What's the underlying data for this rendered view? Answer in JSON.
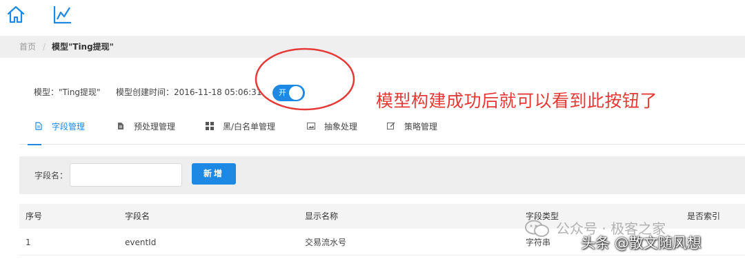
{
  "topnav": {
    "icons": [
      "home-icon",
      "chart-icon"
    ]
  },
  "breadcrumb": {
    "home": "首页",
    "separator": "/",
    "current": "模型\"Ting提现\""
  },
  "model": {
    "name_text": "模型：\"Ting提现\"",
    "created_text": "模型创建时间：2016-11-18 05:06:31",
    "toggle_label": "开",
    "toggle_on": true
  },
  "annotation": {
    "text": "模型构建成功后就可以看到此按钮了",
    "color": "#e53935"
  },
  "tabs": [
    {
      "label": "字段管理",
      "icon": "document-icon",
      "active": true
    },
    {
      "label": "预处理管理",
      "icon": "file-icon",
      "active": false
    },
    {
      "label": "黑/白名单管理",
      "icon": "grid-icon",
      "active": false
    },
    {
      "label": "抽象处理",
      "icon": "image-icon",
      "active": false
    },
    {
      "label": "策略管理",
      "icon": "edit-icon",
      "active": false
    }
  ],
  "filter": {
    "label": "字段名：",
    "input_value": "",
    "add_button": "新增"
  },
  "table": {
    "headers": [
      "序号",
      "字段名",
      "显示名称",
      "字段类型",
      "是否索引"
    ],
    "rows": [
      [
        "1",
        "eventId",
        "交易流水号",
        "字符串",
        ""
      ]
    ]
  },
  "watermarks": {
    "wechat": "公众号 · 极客之家",
    "toutiao": "头条 @散文随风想"
  },
  "colors": {
    "accent": "#1e88e5",
    "annotation": "#e53935"
  }
}
